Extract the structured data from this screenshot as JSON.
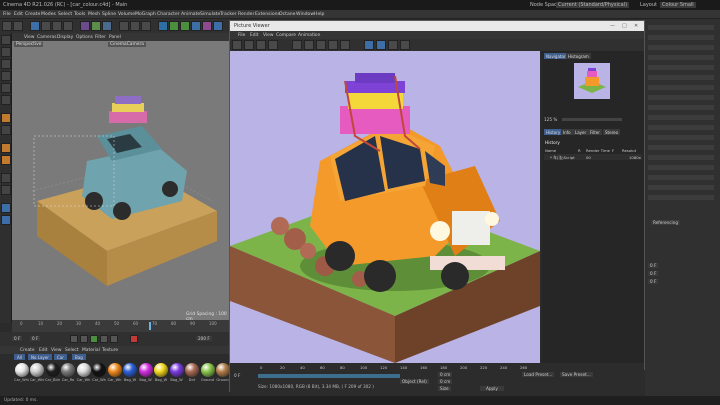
{
  "titlebar": {
    "app_title": "Cinema 4D R21.026 (RC) - [car_colour.c4d] - Main",
    "node_space_label": "Node Space",
    "node_space_value": "Current (Standard/Physical)",
    "layout_label": "Layout",
    "layout_value": "Colour Small"
  },
  "menubar": {
    "items": [
      "File",
      "Edit",
      "Create",
      "Modes",
      "Select",
      "Tools",
      "Mesh",
      "Spline",
      "Volume",
      "MoGraph",
      "Character",
      "Animate",
      "Simulate",
      "Tracker",
      "Render",
      "Extensions",
      "Octane",
      "Window",
      "Help"
    ]
  },
  "viewport": {
    "menu": [
      "View",
      "Cameras",
      "Display",
      "Options",
      "Filter",
      "Panel"
    ],
    "camera_label": "Perspective",
    "camera_name": "CinemaCamera",
    "grid_spacing": "Grid Spacing : 100 cm"
  },
  "timeline": {
    "ticks": [
      "0",
      "10",
      "20",
      "30",
      "40",
      "50",
      "60",
      "70",
      "80",
      "90",
      "100"
    ],
    "current_frame": "0 F",
    "start_frame": "0 F",
    "end_frame": "200 F"
  },
  "material_manager": {
    "menu": [
      "Create",
      "Edit",
      "View",
      "Select",
      "Material",
      "Texture"
    ],
    "tabs": [
      "All",
      "No Layer",
      "Car",
      "Bag"
    ],
    "materials": [
      {
        "name": "Car_Whi",
        "color": "#e8e8e8"
      },
      {
        "name": "Car_Whi",
        "color": "#cfcfcf"
      },
      {
        "name": "Car_Blck",
        "color": "#1e1e1e"
      },
      {
        "name": "Car_Ro",
        "color": "#7a7a7a"
      },
      {
        "name": "Car_Wh",
        "color": "#dcdcdc"
      },
      {
        "name": "Car_Wh",
        "color": "#111111"
      },
      {
        "name": "Car_Wh",
        "color": "#f08a1c"
      },
      {
        "name": "Bag_W",
        "color": "#2b5fd6"
      },
      {
        "name": "Bag_W",
        "color": "#d22ee0"
      },
      {
        "name": "Bag_W",
        "color": "#f2d81d"
      },
      {
        "name": "Bag_W",
        "color": "#7a3be0"
      },
      {
        "name": "Dirt",
        "color": "#a86a55"
      },
      {
        "name": "Ground",
        "color": "#89c64a"
      },
      {
        "name": "Ground",
        "color": "#b37e4a"
      }
    ]
  },
  "status": {
    "text": "Updated: 0 ms."
  },
  "picture_viewer": {
    "title": "Picture Viewer",
    "menu": [
      "File",
      "Edit",
      "View",
      "Compare",
      "Animation"
    ],
    "right_tabs": [
      "Navigator",
      "Histogram"
    ],
    "zoom": "125 %",
    "info_tabs": [
      "History",
      "Info",
      "Layer",
      "Filter",
      "Stereo"
    ],
    "history_title": "History",
    "columns": [
      "Name",
      "R",
      "Render Time",
      "F",
      "Resolut"
    ],
    "history_row": {
      "name": "* 车(法)Script",
      "time": "00",
      "resolution": "1080x"
    },
    "frame_current": "0 F",
    "frame_end": "101 F",
    "size_info": "Size: 1080x1080, RGB (8 Bit), 3.34 MB,  ( F 209 of 302 )",
    "bottom_ticks": [
      "0",
      "20",
      "40",
      "60",
      "80",
      "100",
      "120",
      "140",
      "160",
      "180",
      "200",
      "220",
      "240",
      "260"
    ]
  },
  "attribute": {
    "referencing": "Referencing",
    "rows": [
      "0 F",
      "0 F",
      "0 F"
    ],
    "object_label": "Object (Rel)",
    "size_label": "Size",
    "apply_label": "Apply",
    "load_preset": "Load Preset...",
    "save_preset": "Save Preset...",
    "coord_values": [
      "0 cm",
      "0 cm",
      "0 cm"
    ]
  }
}
